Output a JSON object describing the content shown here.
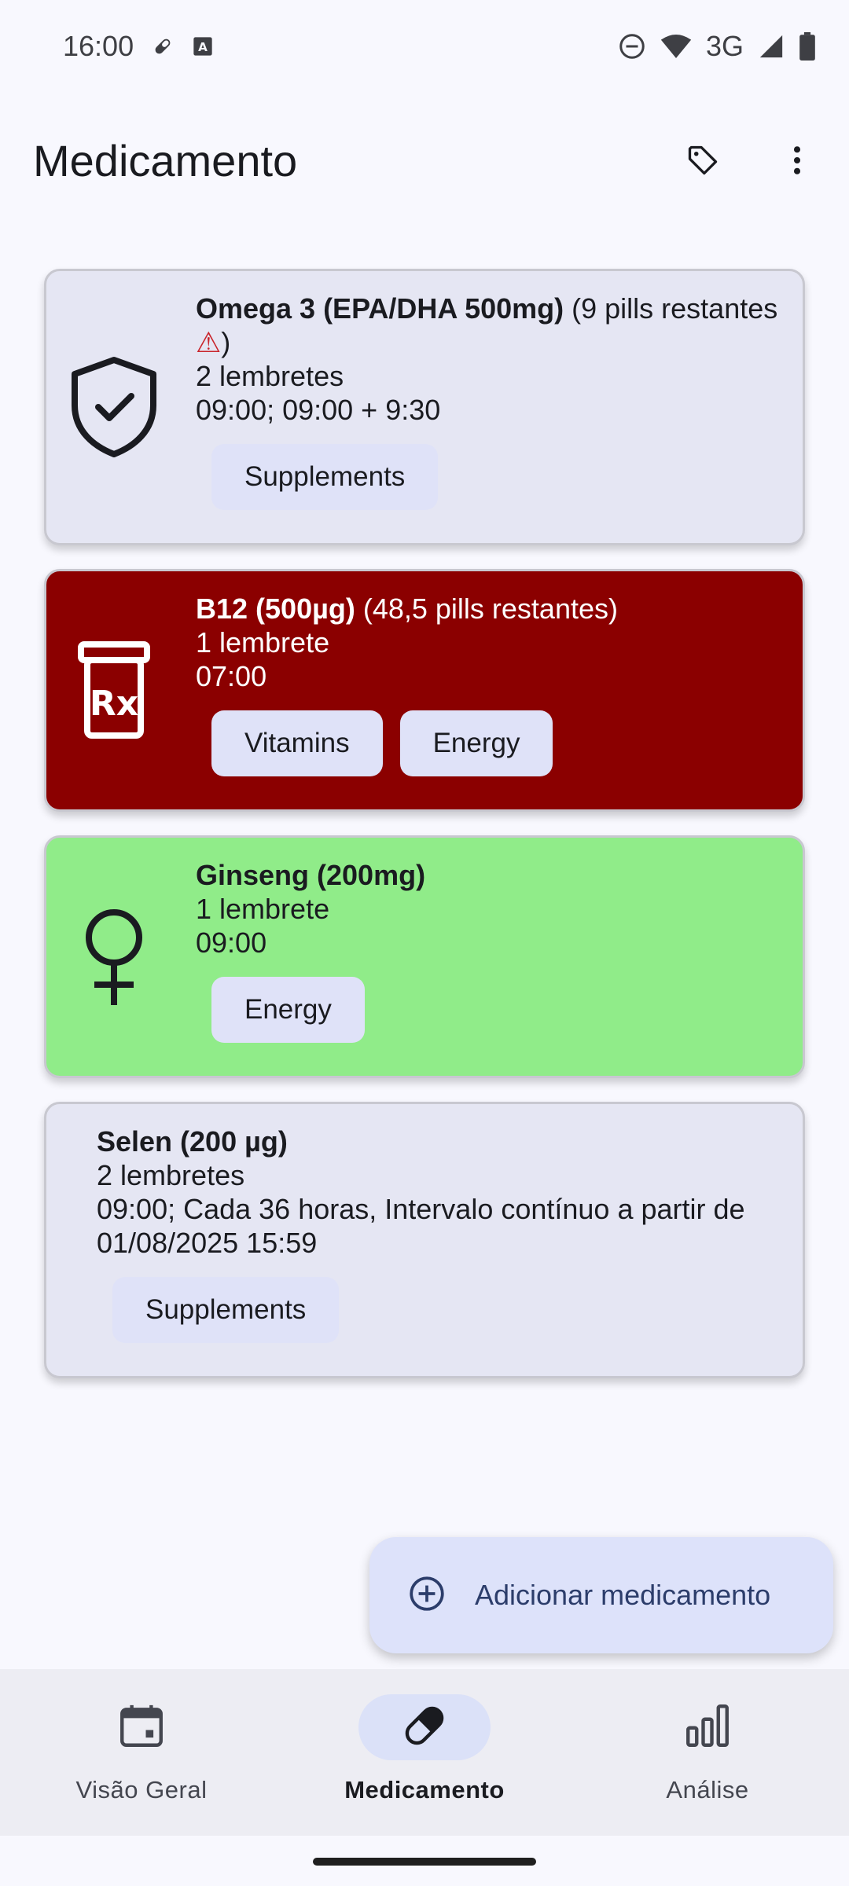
{
  "status_bar": {
    "time": "16:00",
    "network": "3G",
    "icons": [
      "pill-icon",
      "keyboard-icon",
      "dnd-icon",
      "wifi-icon",
      "signal-icon",
      "battery-icon"
    ]
  },
  "app_bar": {
    "title": "Medicamento",
    "actions": [
      "tag-icon",
      "more-vert-icon"
    ]
  },
  "medications": [
    {
      "name": "Omega 3 (EPA/DHA 500mg)",
      "extra": " (9 pills restantes ",
      "warning": "⚠",
      "extra_end": ")",
      "reminders": "2 lembretes",
      "schedule": "09:00; 09:00 + 9:30",
      "tags": [
        "Supplements"
      ],
      "icon": "shield-check-icon",
      "background": "#e5e6f3"
    },
    {
      "name": "B12 (500µg)",
      "extra": " (48,5 pills restantes)",
      "reminders": "1 lembrete",
      "schedule": "07:00",
      "tags": [
        "Vitamins",
        "Energy"
      ],
      "icon": "prescription-bottle-icon",
      "background": "#8b0000"
    },
    {
      "name": "Ginseng (200mg)",
      "reminders": "1 lembrete",
      "schedule": "09:00",
      "tags": [
        "Energy"
      ],
      "icon": "female-symbol-icon",
      "background": "#90ec89"
    },
    {
      "name": "Selen (200 µg)",
      "reminders": "2 lembretes",
      "schedule": "09:00; Cada 36 horas, Intervalo contínuo a partir de 01/08/2025 15:59",
      "tags": [
        "Supplements"
      ],
      "background": "#e5e6f3"
    }
  ],
  "fab": {
    "label": "Adicionar medicamento",
    "icon": "add-circle-icon"
  },
  "bottom_nav": {
    "items": [
      {
        "label": "Visão Geral",
        "icon": "calendar-icon",
        "active": false
      },
      {
        "label": "Medicamento",
        "icon": "pill-icon",
        "active": true
      },
      {
        "label": "Análise",
        "icon": "bar-chart-icon",
        "active": false
      }
    ]
  },
  "colors": {
    "background": "#f8f8fe",
    "accent": "#dbe1f8",
    "warning": "#c9252c"
  }
}
